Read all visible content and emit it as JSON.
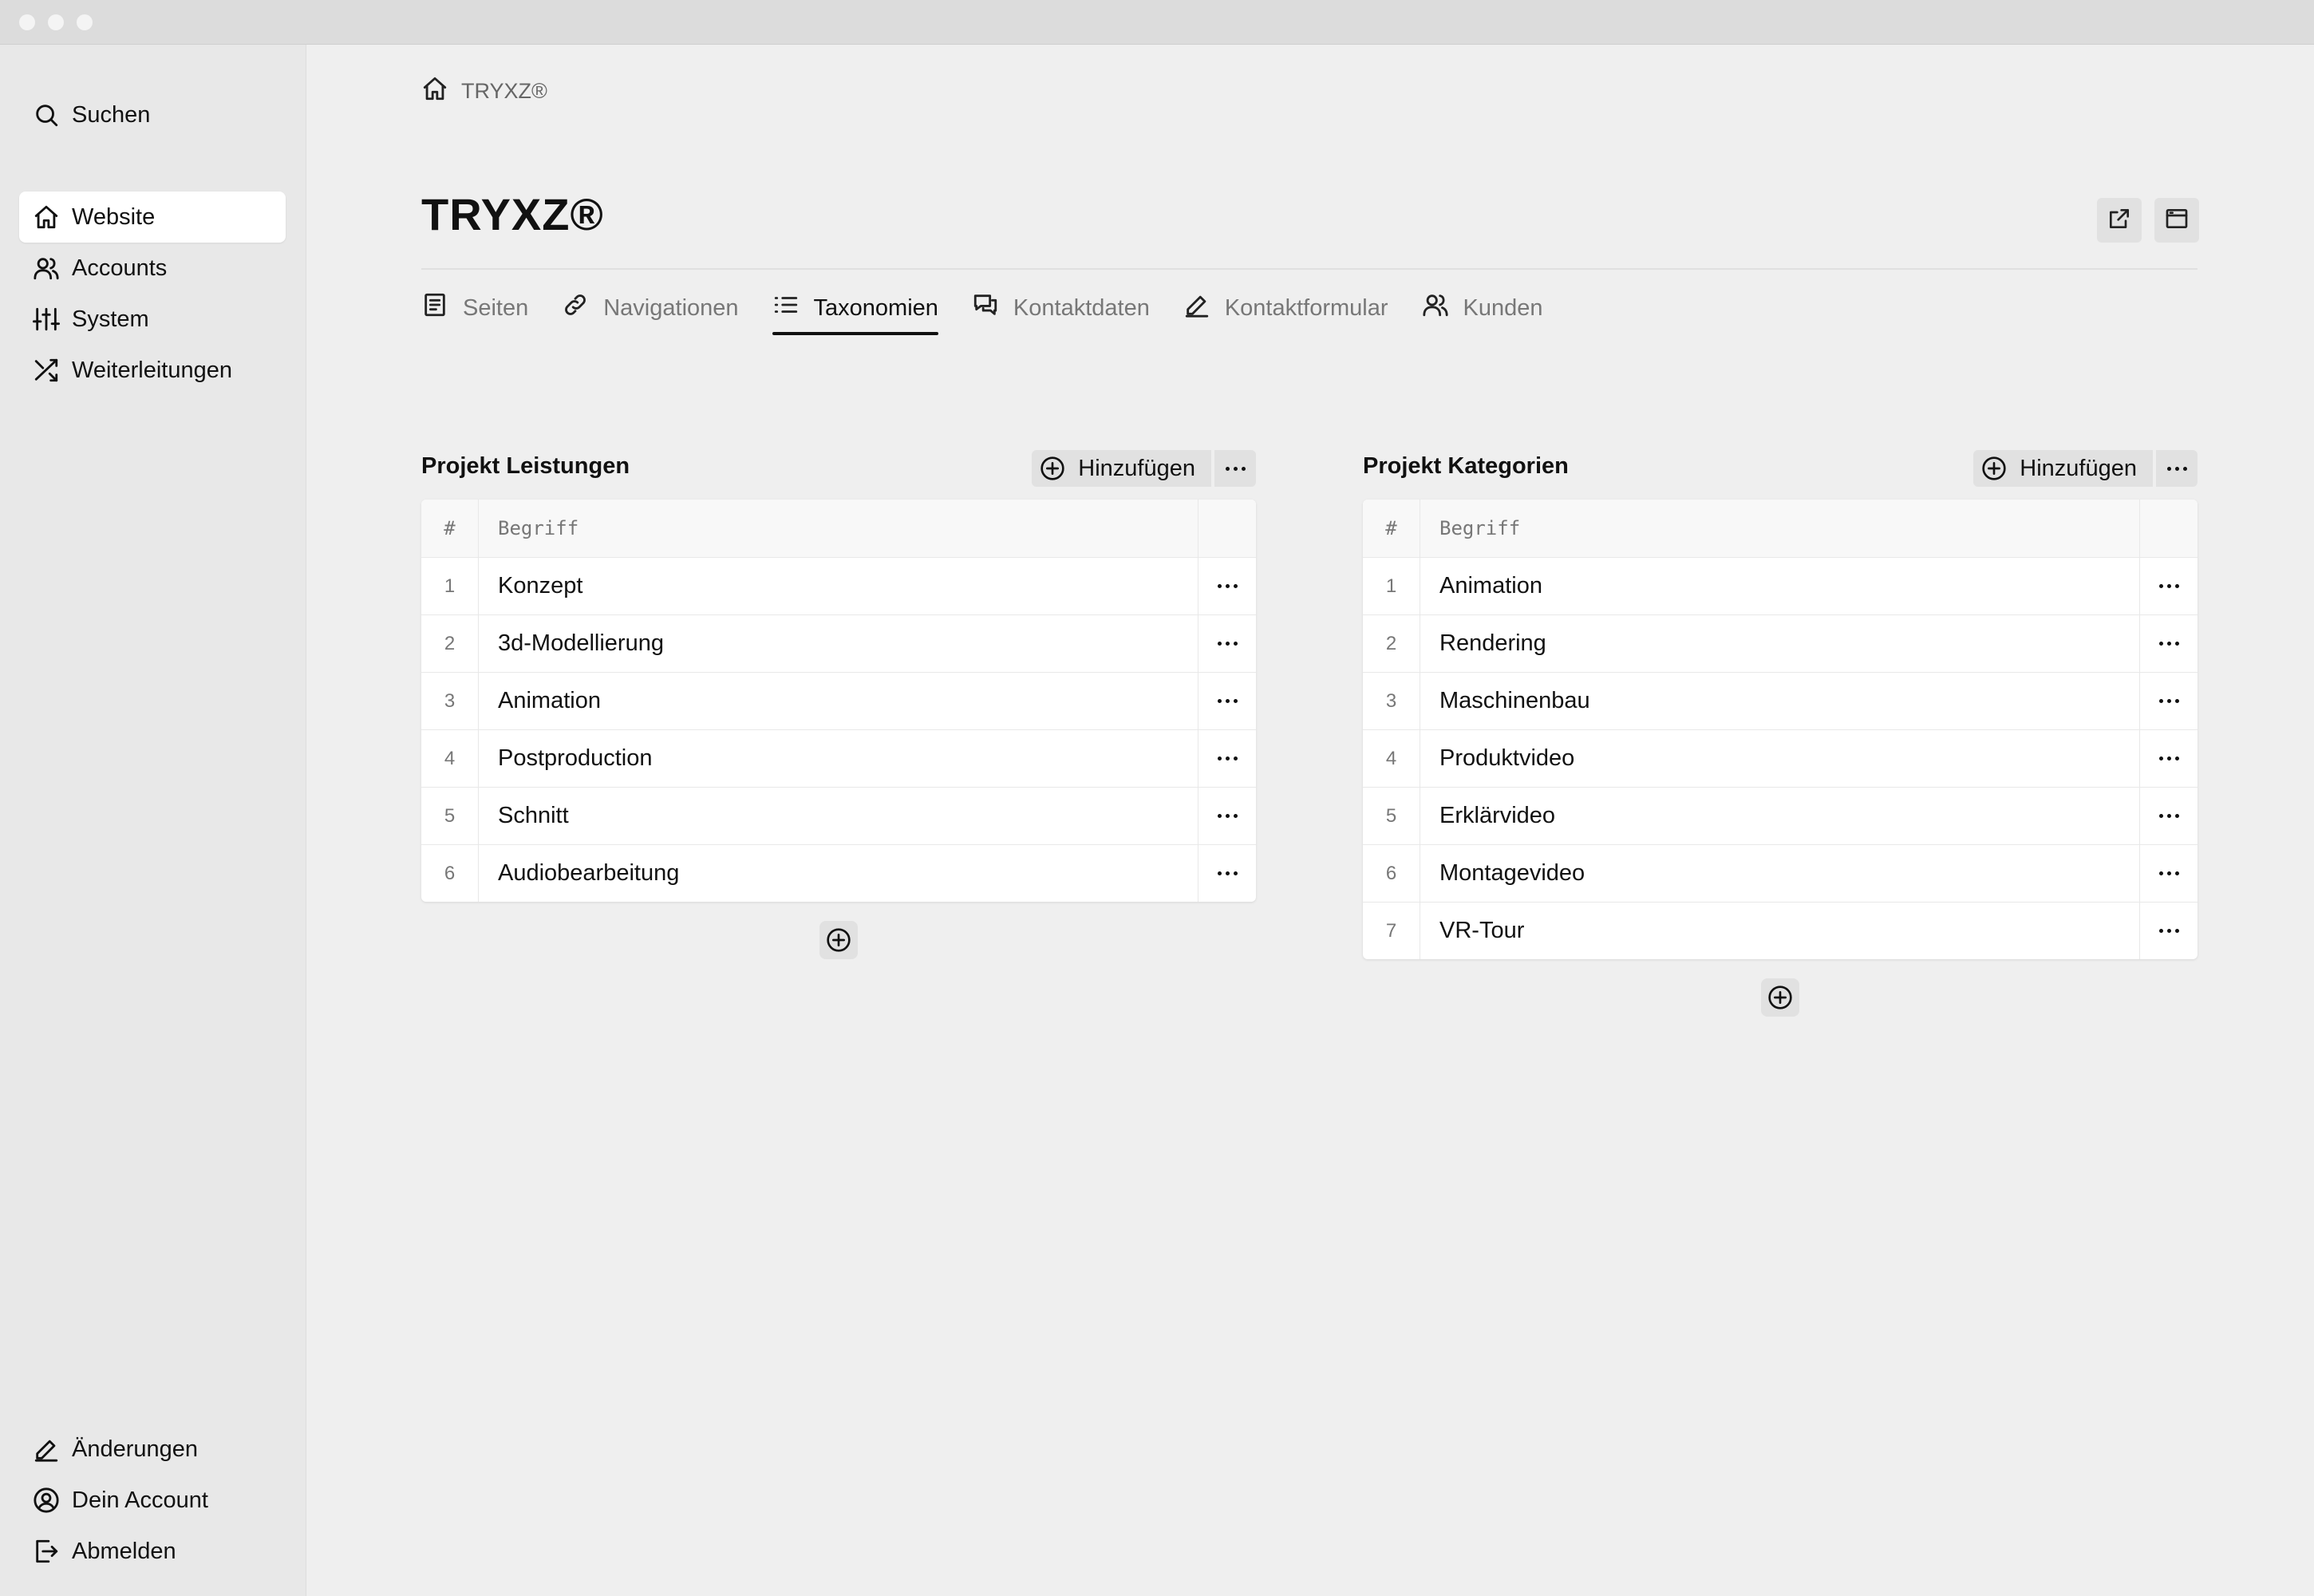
{
  "sidebar": {
    "search_label": "Suchen",
    "nav": [
      {
        "label": "Website",
        "icon": "home-icon",
        "active": true
      },
      {
        "label": "Accounts",
        "icon": "users-icon",
        "active": false
      },
      {
        "label": "System",
        "icon": "sliders-icon",
        "active": false
      },
      {
        "label": "Weiterleitungen",
        "icon": "shuffle-icon",
        "active": false
      }
    ],
    "bottom": [
      {
        "label": "Änderungen",
        "icon": "pencil-icon"
      },
      {
        "label": "Dein Account",
        "icon": "user-circle-icon"
      },
      {
        "label": "Abmelden",
        "icon": "logout-icon"
      }
    ]
  },
  "breadcrumb": {
    "label": "TRYXZ®"
  },
  "page": {
    "title": "TRYXZ®"
  },
  "tabs": [
    {
      "label": "Seiten",
      "icon": "page-icon",
      "active": false
    },
    {
      "label": "Navigationen",
      "icon": "link-icon",
      "active": false
    },
    {
      "label": "Taxonomien",
      "icon": "list-icon",
      "active": true
    },
    {
      "label": "Kontaktdaten",
      "icon": "chat-icon",
      "active": false
    },
    {
      "label": "Kontaktformular",
      "icon": "pencil-icon",
      "active": false
    },
    {
      "label": "Kunden",
      "icon": "users-icon",
      "active": false
    }
  ],
  "sections": [
    {
      "title": "Projekt Leistungen",
      "add_label": "Hinzufügen",
      "columns": {
        "num": "#",
        "term": "Begriff"
      },
      "rows": [
        {
          "num": "1",
          "term": "Konzept"
        },
        {
          "num": "2",
          "term": "3d-Modellierung"
        },
        {
          "num": "3",
          "term": "Animation"
        },
        {
          "num": "4",
          "term": "Postproduction"
        },
        {
          "num": "5",
          "term": "Schnitt"
        },
        {
          "num": "6",
          "term": "Audiobearbeitung"
        }
      ]
    },
    {
      "title": "Projekt Kategorien",
      "add_label": "Hinzufügen",
      "columns": {
        "num": "#",
        "term": "Begriff"
      },
      "rows": [
        {
          "num": "1",
          "term": "Animation"
        },
        {
          "num": "2",
          "term": "Rendering"
        },
        {
          "num": "3",
          "term": "Maschinenbau"
        },
        {
          "num": "4",
          "term": "Produktvideo"
        },
        {
          "num": "5",
          "term": "Erklärvideo"
        },
        {
          "num": "6",
          "term": "Montagevideo"
        },
        {
          "num": "7",
          "term": "VR-Tour"
        }
      ]
    }
  ]
}
